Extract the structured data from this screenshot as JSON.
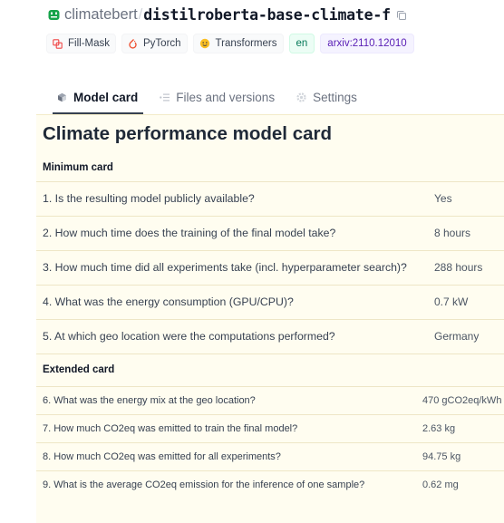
{
  "repo": {
    "owner": "climatebert",
    "separator": "/",
    "name": "distilroberta-base-climate-f"
  },
  "tags": [
    {
      "label": "Fill-Mask",
      "icon": "fill-mask-icon"
    },
    {
      "label": "PyTorch",
      "icon": "pytorch-icon"
    },
    {
      "label": "Transformers",
      "icon": "transformers-icon"
    },
    {
      "label": "en",
      "icon": ""
    },
    {
      "label": "arxiv:2110.12010",
      "icon": ""
    }
  ],
  "tabs": [
    {
      "label": "Model card",
      "icon": "model-card-icon",
      "active": true
    },
    {
      "label": "Files and versions",
      "icon": "files-icon",
      "active": false
    },
    {
      "label": "Settings",
      "icon": "settings-icon",
      "active": false
    }
  ],
  "card": {
    "title": "Climate performance model card",
    "minimum": {
      "heading": "Minimum card",
      "rows": [
        {
          "q": "1. Is the resulting model publicly available?",
          "a": "Yes"
        },
        {
          "q": "2. How much time does the training of the final model take?",
          "a": "8 hours"
        },
        {
          "q": "3. How much time did all experiments take (incl. hyperparameter search)?",
          "a": "288 hours"
        },
        {
          "q": "4. What was the energy consumption (GPU/CPU)?",
          "a": "0.7 kW"
        },
        {
          "q": "5. At which geo location were the computations performed?",
          "a": "Germany"
        }
      ]
    },
    "extended": {
      "heading": "Extended card",
      "rows": [
        {
          "q": "6. What was the energy mix at the geo location?",
          "a": "470 gCO2eq/kWh"
        },
        {
          "q": "7. How much CO2eq was emitted to train the final model?",
          "a": "2.63 kg"
        },
        {
          "q": "8. How much CO2eq was emitted for all experiments?",
          "a": "94.75 kg"
        },
        {
          "q": "9. What is the average CO2eq emission for the inference of one sample?",
          "a": "0.62 mg"
        }
      ]
    }
  },
  "colors": {
    "card_background": "#fffdf0",
    "lang_tag": "#047857",
    "arxiv_tag": "#5b21b6",
    "logo": "#16a34a"
  }
}
